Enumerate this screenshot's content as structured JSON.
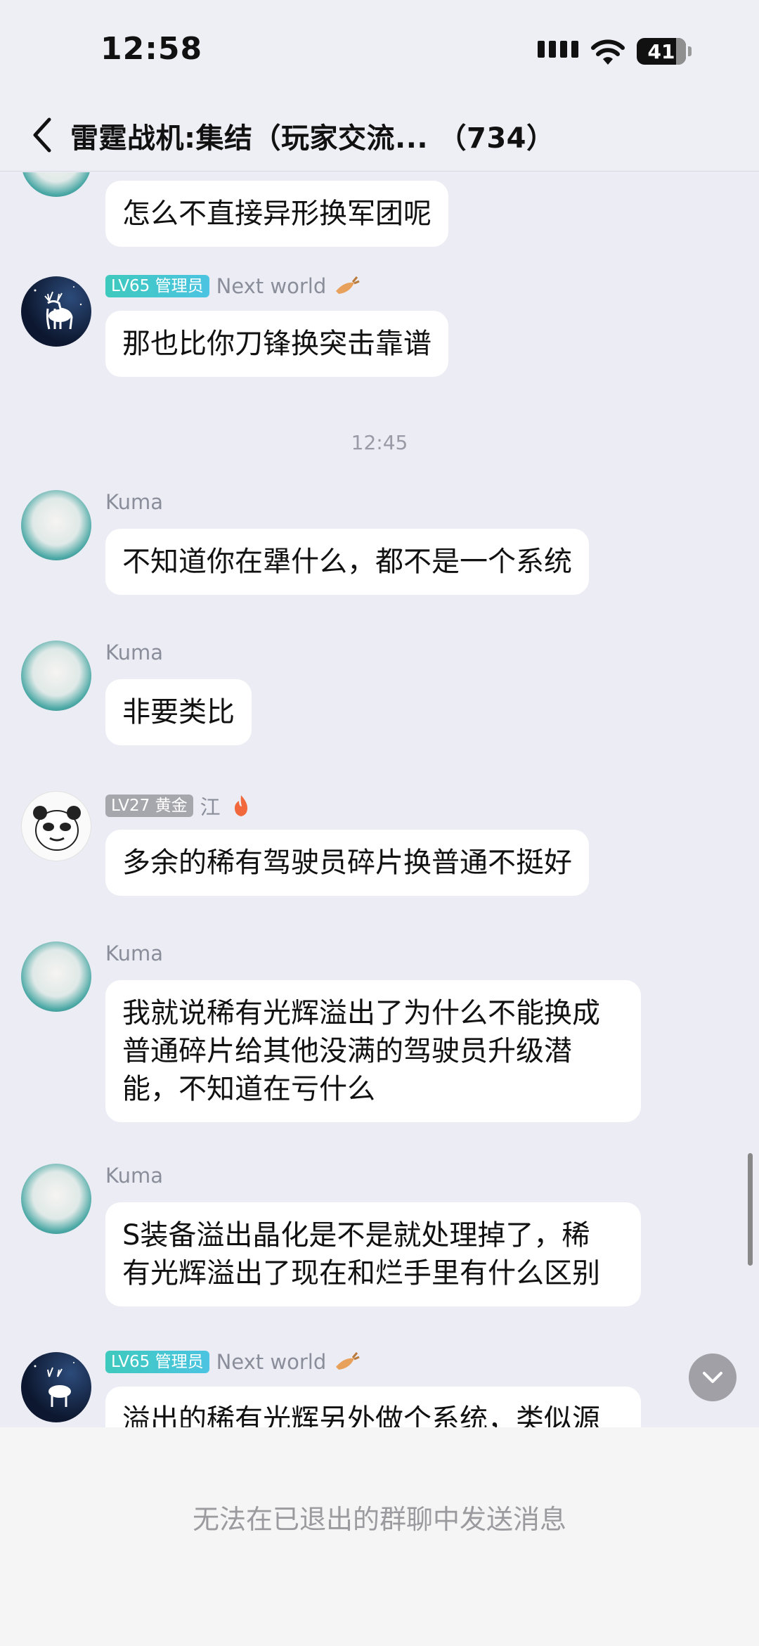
{
  "status_bar": {
    "time": "12:58",
    "battery": "41"
  },
  "header": {
    "title": "雷霆战机:集结（玩家交流... （734）"
  },
  "messages": [
    {
      "text": "怎么不直接异形换军团呢"
    },
    {
      "sender": "Next world",
      "badge": "LV65 管理员",
      "text": "那也比你刀锋换突击靠谱"
    },
    {
      "divider": "12:45"
    },
    {
      "sender": "Kuma",
      "text": "不知道你在犟什么，都不是一个系统"
    },
    {
      "sender": "Kuma",
      "text": "非要类比"
    },
    {
      "sender": "江",
      "badge": "LV27 黄金",
      "text": "多余的稀有驾驶员碎片换普通不挺好"
    },
    {
      "sender": "Kuma",
      "text_lines": [
        "我就说稀有光辉溢出了为什么不能换成",
        "普通碎片给其他没满的驾驶员升级潜",
        "能，不知道在亏什么"
      ]
    },
    {
      "sender": "Kuma",
      "text_lines": [
        "S装备溢出晶化是不是就处理掉了，稀",
        "有光辉溢出了现在和烂手里有什么区别"
      ]
    },
    {
      "sender": "Next world",
      "badge": "LV65 管理员",
      "text": "溢出的稀有光辉另外做个系统，类似源"
    }
  ],
  "footer": {
    "notice": "无法在已退出的群聊中发送消息"
  },
  "colors": {
    "admin_badge": "#3ec9bd",
    "gold_badge": "#a6a6ad",
    "background": "#ececf4",
    "bubble": "#ffffff"
  }
}
